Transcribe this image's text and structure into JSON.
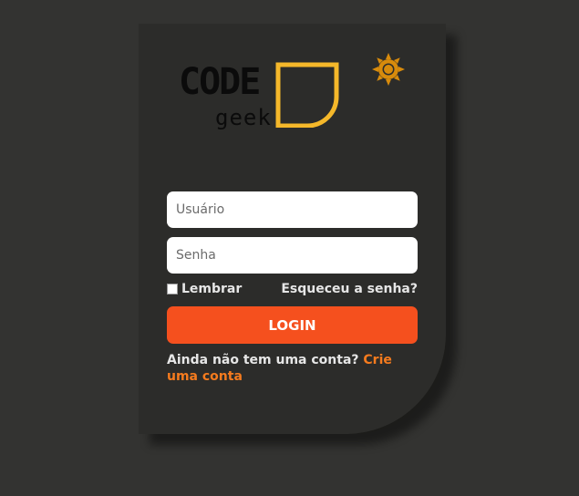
{
  "logo": {
    "word_code": "CODE",
    "word_geek": "geek"
  },
  "theme_toggle": {
    "icon": "sun-icon"
  },
  "form": {
    "username_placeholder": "Usuário",
    "password_placeholder": "Senha",
    "remember_label": "Lembrar",
    "forgot_link": "Esqueceu a senha?",
    "login_button": "LOGIN",
    "signup_prompt": "Ainda não tem uma conta? ",
    "signup_link": "Crie uma conta"
  },
  "colors": {
    "page_background": "#333331",
    "card_background": "#2c2c2a",
    "brand_yellow": "#f5b82a",
    "login_button": "#f5501e",
    "link_orange": "#f57b1e",
    "sun_icon": "#d88b0c"
  }
}
